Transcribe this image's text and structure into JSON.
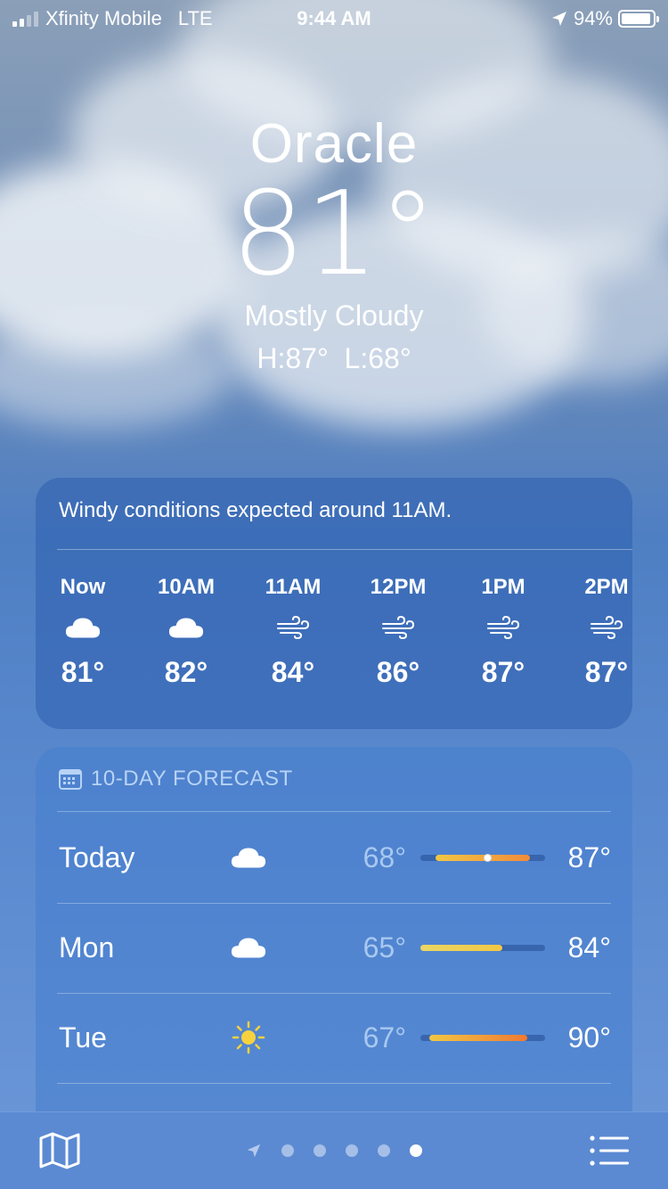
{
  "status_bar": {
    "carrier": "Xfinity Mobile",
    "network": "LTE",
    "time": "9:44 AM",
    "battery": "94%",
    "battery_level": 0.94,
    "signal_bars": 2
  },
  "location": {
    "city": "Oracle",
    "temperature": "81°",
    "condition": "Mostly Cloudy",
    "high_low": "H:87°  L:68°"
  },
  "hourly": {
    "note": "Windy conditions expected around 11AM.",
    "hours": [
      {
        "label": "Now",
        "icon": "cloud-icon",
        "temp": "81°"
      },
      {
        "label": "10AM",
        "icon": "cloud-icon",
        "temp": "82°"
      },
      {
        "label": "11AM",
        "icon": "wind-icon",
        "temp": "84°"
      },
      {
        "label": "12PM",
        "icon": "wind-icon",
        "temp": "86°"
      },
      {
        "label": "1PM",
        "icon": "wind-icon",
        "temp": "87°"
      },
      {
        "label": "2PM",
        "icon": "wind-icon",
        "temp": "87°"
      }
    ]
  },
  "ten_day": {
    "title": "10-DAY FORECAST",
    "days": [
      {
        "name": "Today",
        "icon": "cloud-icon",
        "low": "68°",
        "high": "87°",
        "range_start": 0.12,
        "range_end": 0.88,
        "current": 0.54,
        "colors": [
          "#f2c744",
          "#f28b3a"
        ]
      },
      {
        "name": "Mon",
        "icon": "cloud-icon",
        "low": "65°",
        "high": "84°",
        "range_start": 0.0,
        "range_end": 0.66,
        "colors": [
          "#e9d765",
          "#f2c744"
        ]
      },
      {
        "name": "Tue",
        "icon": "sun-icon",
        "low": "67°",
        "high": "90°",
        "range_start": 0.07,
        "range_end": 0.86,
        "colors": [
          "#f2c744",
          "#f07a32"
        ]
      }
    ]
  },
  "toolbar": {
    "page_count": 5,
    "active_page": 5
  },
  "colors": {
    "accent_label": "#b8d3f5",
    "low_temp": "#a8c8f0"
  }
}
